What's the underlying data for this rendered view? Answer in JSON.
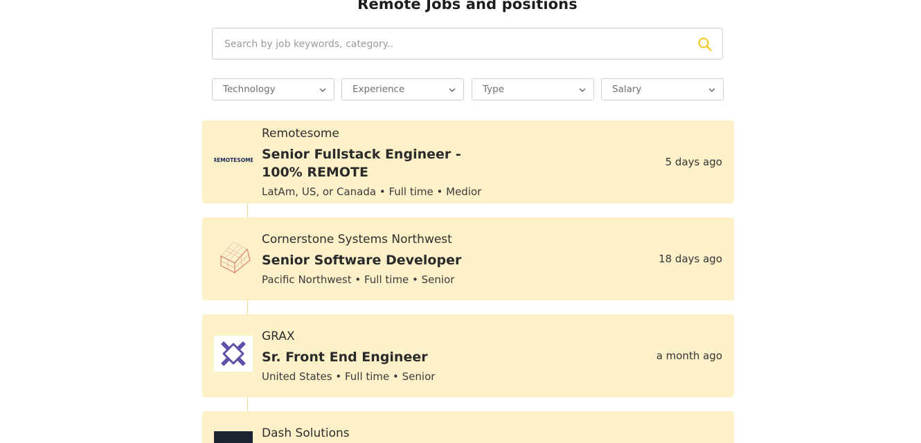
{
  "page": {
    "title": "Remote Jobs and positions"
  },
  "search": {
    "placeholder": "Search by job keywords, category..",
    "icon": "search-icon",
    "icon_color": "#f5c518"
  },
  "filters": [
    {
      "label": "Technology"
    },
    {
      "label": "Experience"
    },
    {
      "label": "Type"
    },
    {
      "label": "Salary"
    }
  ],
  "colors": {
    "card_bg": "#fdf1c9",
    "timeline": "#f1d98a",
    "grax_logo": "#5b4fa8",
    "dash_logo": "#1f2433"
  },
  "jobs": [
    {
      "company": "Remotesome",
      "logo_text": "REMOTESOME",
      "title": "Senior Fullstack Engineer - 100% REMOTE",
      "meta": "LatAm, US, or Canada • Full time • Medior",
      "posted": "5 days ago"
    },
    {
      "company": "Cornerstone Systems Northwest",
      "title": "Senior Software Developer",
      "meta": "Pacific Northwest • Full time • Senior",
      "posted": "18 days ago"
    },
    {
      "company": "GRAX",
      "title": "Sr. Front End Engineer",
      "meta": "United States • Full time • Senior",
      "posted": "a month ago"
    },
    {
      "company": "Dash Solutions"
    }
  ]
}
